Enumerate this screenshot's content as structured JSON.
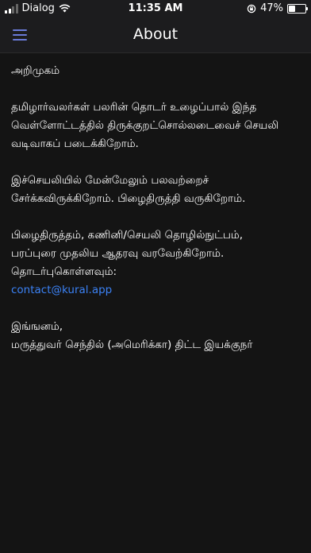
{
  "status_bar": {
    "carrier": "Dialog",
    "time": "11:35 AM",
    "battery_percent": "47%",
    "battery_level": 0.47,
    "icons": [
      "signal-icon",
      "wifi-icon",
      "orientation-lock-icon",
      "battery-icon"
    ]
  },
  "nav": {
    "title": "About",
    "menu_icon": "hamburger-menu-icon",
    "accent": "#6a7bd8"
  },
  "content": {
    "heading": "அறிமுகம்",
    "para1": [
      "தமிழார்வலர்கள் பலரின் தொடர் உழைப்பால் இந்த",
      "வெள்ளோட்டத்தில் திருக்குறட்சொல்லடைவைச் செயலி",
      "வடிவாகப் படைக்கிறோம்."
    ],
    "para2": [
      "இச்செயலியில் மேன்மேலும் பலவற்றைச்",
      "சேர்க்கவிருக்கிறோம். பிழைதிருத்தி வருகிறோம்."
    ],
    "para3": [
      "பிழைதிருத்தம், கணினி/செயலி தொழில்நுட்பம்,",
      "பரப்புரை முதலிய ஆதரவு வரவேற்கிறோம்.",
      "தொடர்புகொள்ளவும்:"
    ],
    "email": "contact@kural.app",
    "link_color": "#3b82f6",
    "para4": [
      "இங்ஙனம்,",
      "மருத்துவர் செந்தில் (அமெரிக்கா) திட்ட இயக்குநர்"
    ]
  }
}
